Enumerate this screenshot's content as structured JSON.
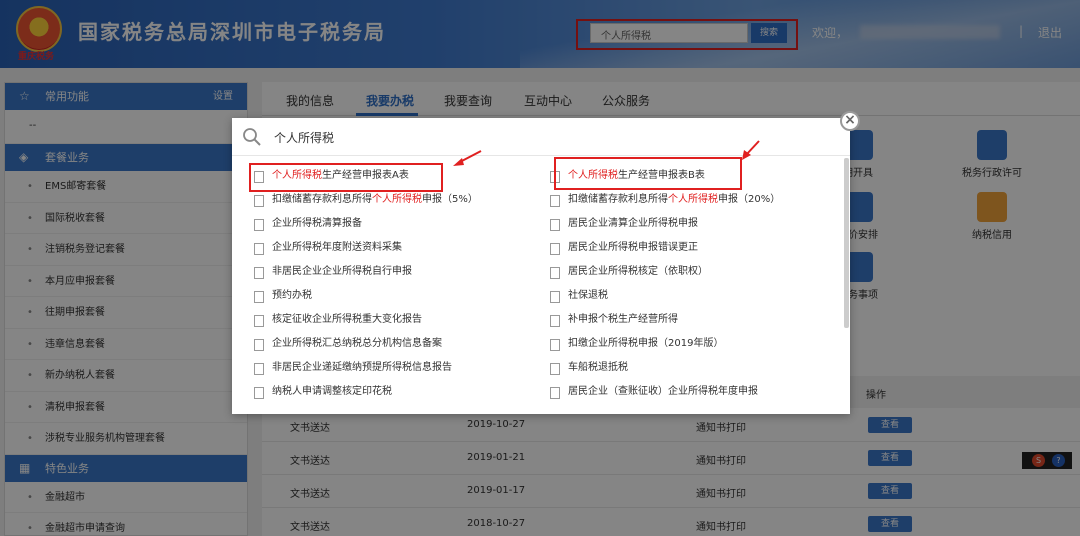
{
  "header": {
    "emblem_text": "重庆税务",
    "site_title": "国家税务总局深圳市电子税务局",
    "search_value": "个人所得税",
    "search_button": "搜索",
    "welcome": "欢迎，",
    "separator": "|",
    "logout": "退出"
  },
  "sidebar": {
    "sections": [
      {
        "title": "常用功能",
        "icon": "star-icon",
        "extra": "设置",
        "items": [
          {
            "label": "--",
            "plain": true
          }
        ]
      },
      {
        "title": "套餐业务",
        "icon": "layers-icon",
        "items": [
          {
            "label": "EMS邮寄套餐"
          },
          {
            "label": "国际税收套餐"
          },
          {
            "label": "注销税务登记套餐"
          },
          {
            "label": "本月应申报套餐"
          },
          {
            "label": "往期申报套餐"
          },
          {
            "label": "违章信息套餐"
          },
          {
            "label": "新办纳税人套餐"
          },
          {
            "label": "清税申报套餐"
          },
          {
            "label": "涉税专业服务机构管理套餐"
          }
        ]
      },
      {
        "title": "特色业务",
        "icon": "grid-icon",
        "items": [
          {
            "label": "金融超市"
          },
          {
            "label": "金融超市申请查询"
          }
        ]
      }
    ]
  },
  "main": {
    "tabs": [
      {
        "label": "我的信息"
      },
      {
        "label": "我要办税",
        "active": true
      },
      {
        "label": "我要查询"
      },
      {
        "label": "互动中心"
      },
      {
        "label": "公众服务"
      }
    ],
    "tiles": [
      {
        "label": "期开具",
        "color": "#3b78c9"
      },
      {
        "label": "税务行政许可",
        "color": "#3b78c9"
      },
      {
        "label": "定价安排",
        "color": "#3b78c9"
      },
      {
        "label": "纳税信用",
        "color": "#f1a33a"
      },
      {
        "label": "服务事项",
        "color": "#3b78c9"
      }
    ],
    "table": {
      "col_action": "操作",
      "rows": [
        {
          "name": "文书送达",
          "date": "2019-10-27",
          "action": "通知书打印",
          "button": "查看"
        },
        {
          "name": "文书送达",
          "date": "2019-01-21",
          "action": "通知书打印",
          "button": "查看"
        },
        {
          "name": "文书送达",
          "date": "2019-01-17",
          "action": "通知书打印",
          "button": "查看"
        },
        {
          "name": "文书送达",
          "date": "2018-10-27",
          "action": "通知书打印",
          "button": "查看"
        }
      ]
    }
  },
  "modal": {
    "search_value": "个人所得税",
    "close": "×",
    "left": [
      {
        "pre": "",
        "hl": "个人所得税",
        "post": "生产经营申报表A表"
      },
      {
        "pre": "扣缴储蓄存款利息所得",
        "hl": "个人所得税",
        "post": "申报（5%）"
      },
      {
        "pre": "企业所得税清算报备",
        "hl": "",
        "post": ""
      },
      {
        "pre": "企业所得税年度附送资料采集",
        "hl": "",
        "post": ""
      },
      {
        "pre": "非居民企业企业所得税自行申报",
        "hl": "",
        "post": ""
      },
      {
        "pre": "预约办税",
        "hl": "",
        "post": ""
      },
      {
        "pre": "核定征收企业所得税重大变化报告",
        "hl": "",
        "post": ""
      },
      {
        "pre": "企业所得税汇总纳税总分机构信息备案",
        "hl": "",
        "post": ""
      },
      {
        "pre": "非居民企业递延缴纳预提所得税信息报告",
        "hl": "",
        "post": ""
      },
      {
        "pre": "纳税人申请调整核定印花税",
        "hl": "",
        "post": ""
      }
    ],
    "right": [
      {
        "pre": "",
        "hl": "个人所得税",
        "post": "生产经营申报表B表"
      },
      {
        "pre": "扣缴储蓄存款利息所得",
        "hl": "个人所得税",
        "post": "申报（20%）"
      },
      {
        "pre": "居民企业清算企业所得税申报",
        "hl": "",
        "post": ""
      },
      {
        "pre": "居民企业所得税申报错误更正",
        "hl": "",
        "post": ""
      },
      {
        "pre": "居民企业所得税核定（依职权）",
        "hl": "",
        "post": ""
      },
      {
        "pre": "社保退税",
        "hl": "",
        "post": ""
      },
      {
        "pre": "补申报个税生产经营所得",
        "hl": "",
        "post": ""
      },
      {
        "pre": "扣缴企业所得税申报（2019年版）",
        "hl": "",
        "post": ""
      },
      {
        "pre": "车船税退抵税",
        "hl": "",
        "post": ""
      },
      {
        "pre": "居民企业（查账征收）企业所得税年度申报",
        "hl": "",
        "post": ""
      }
    ]
  },
  "widget": {
    "s_label": "S",
    "q_label": "?"
  },
  "colors": {
    "accent": "#3b78c9",
    "highlight": "#e02020"
  }
}
